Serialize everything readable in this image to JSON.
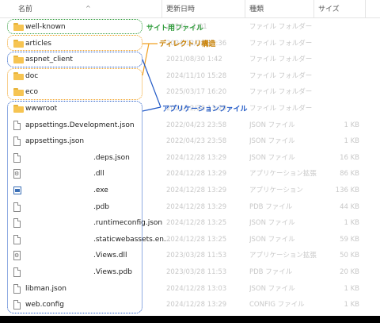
{
  "columns": {
    "name": "名前",
    "date": "更新日時",
    "type": "種類",
    "size": "サイズ"
  },
  "callouts": {
    "site": "サイト用ファイル",
    "dirs": "ディレクトリ構造",
    "app": "アプリケーションファイル"
  },
  "rows": [
    {
      "name": "well-known",
      "date": "2024/...1:01",
      "type": "ファイル フォルダー",
      "size": "",
      "icon": "folder-icon"
    },
    {
      "name": "articles",
      "date": "2024/12/28 13:36",
      "type": "ファイル フォルダー",
      "size": "",
      "icon": "folder-icon"
    },
    {
      "name": "aspnet_client",
      "date": "2021/08/30 1:42",
      "type": "ファイル フォルダー",
      "size": "",
      "icon": "folder-icon"
    },
    {
      "name": "doc",
      "date": "2024/11/10 15:28",
      "type": "ファイル フォルダー",
      "size": "",
      "icon": "folder-icon"
    },
    {
      "name": "eco",
      "date": "2025/03/17 16:20",
      "type": "ファイル フォルダー",
      "size": "",
      "icon": "folder-icon"
    },
    {
      "name": "wwwroot",
      "date": "2024/12/28 13:29",
      "type": "ファイル フォルダー",
      "size": "",
      "icon": "folder-icon"
    },
    {
      "name": "appsettings.Development.json",
      "date": "2022/04/23 23:58",
      "type": "JSON ファイル",
      "size": "1 KB",
      "icon": "file-icon"
    },
    {
      "name": "appsettings.json",
      "date": "2022/04/23 23:58",
      "type": "JSON ファイル",
      "size": "1 KB",
      "icon": "file-icon"
    },
    {
      "name": ".deps.json",
      "date": "2024/12/28 13:29",
      "type": "JSON ファイル",
      "size": "16 KB",
      "icon": "file-icon"
    },
    {
      "name": ".dll",
      "date": "2024/12/28 13:29",
      "type": "アプリケーション拡張",
      "size": "86 KB",
      "icon": "dll-icon"
    },
    {
      "name": ".exe",
      "date": "2024/12/28 13:29",
      "type": "アプリケーション",
      "size": "136 KB",
      "icon": "exe-icon"
    },
    {
      "name": ".pdb",
      "date": "2024/12/28 13:29",
      "type": "PDB ファイル",
      "size": "44 KB",
      "icon": "file-icon"
    },
    {
      "name": ".runtimeconfig.json",
      "date": "2024/12/28 13:25",
      "type": "JSON ファイル",
      "size": "1 KB",
      "icon": "file-icon"
    },
    {
      "name": ".staticwebassets.en...",
      "date": "2024/12/28 13:25",
      "type": "JSON ファイル",
      "size": "59 KB",
      "icon": "file-icon"
    },
    {
      "name": ".Views.dll",
      "date": "2023/03/28 11:53",
      "type": "アプリケーション拡張",
      "size": "50 KB",
      "icon": "dll-icon"
    },
    {
      "name": ".Views.pdb",
      "date": "2023/03/28 11:53",
      "type": "PDB ファイル",
      "size": "20 KB",
      "icon": "file-icon"
    },
    {
      "name": "libman.json",
      "date": "2024/12/28 13:03",
      "type": "JSON ファイル",
      "size": "1 KB",
      "icon": "file-icon"
    },
    {
      "name": "web.config",
      "date": "2024/12/28 13:29",
      "type": "CONFIG ファイル",
      "size": "1 KB",
      "icon": "file-icon"
    }
  ],
  "colors": {
    "green": "#2e9b3a",
    "orange": "#f0a020",
    "blue": "#2159c6"
  }
}
